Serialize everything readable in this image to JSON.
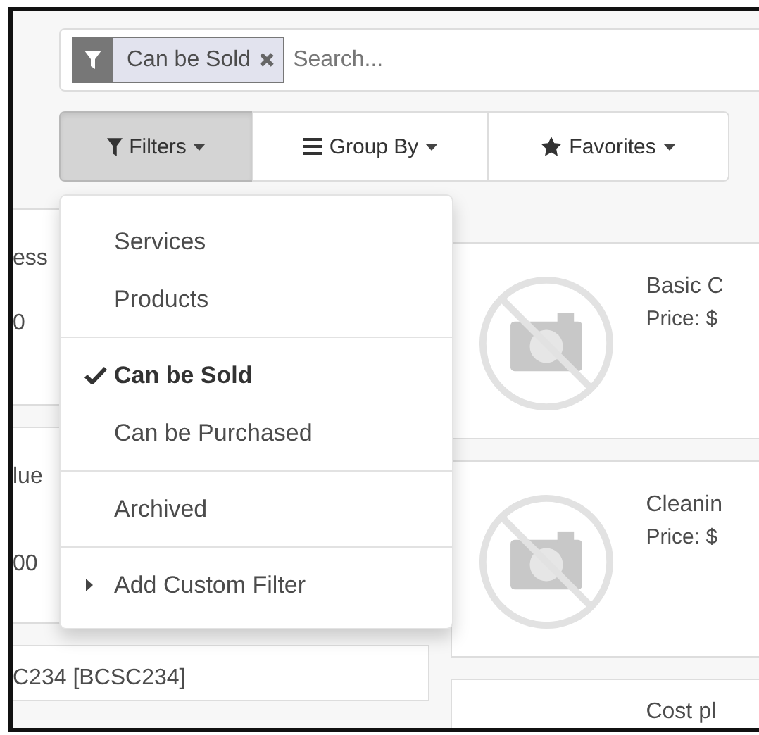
{
  "search": {
    "facets": [
      {
        "label": "Can be Sold"
      }
    ],
    "placeholder": "Search..."
  },
  "toolbar": [
    {
      "label": "Filters",
      "selected": true,
      "kind": "filter"
    },
    {
      "label": "Group By",
      "selected": false,
      "kind": "group"
    },
    {
      "label": "Favorites",
      "selected": false,
      "kind": "star"
    }
  ],
  "filters_menu": {
    "groups": [
      [
        {
          "label": "Services",
          "checked": false
        },
        {
          "label": "Products",
          "checked": false
        }
      ],
      [
        {
          "label": "Can be Sold",
          "checked": true
        },
        {
          "label": "Can be Purchased",
          "checked": false
        }
      ],
      [
        {
          "label": "Archived",
          "checked": false
        }
      ]
    ],
    "custom_filter": "Add Custom Filter"
  },
  "products_left": [
    {
      "name": "ess",
      "price": "0"
    },
    {
      "name": "lue",
      "price": "00"
    },
    {
      "name": "C234 [BCSC234]"
    }
  ],
  "products_right": [
    {
      "name": "Basic C",
      "price": "Price: $"
    },
    {
      "name": "Cleanin",
      "price": "Price: $"
    },
    {
      "name": "Cost pl"
    }
  ]
}
